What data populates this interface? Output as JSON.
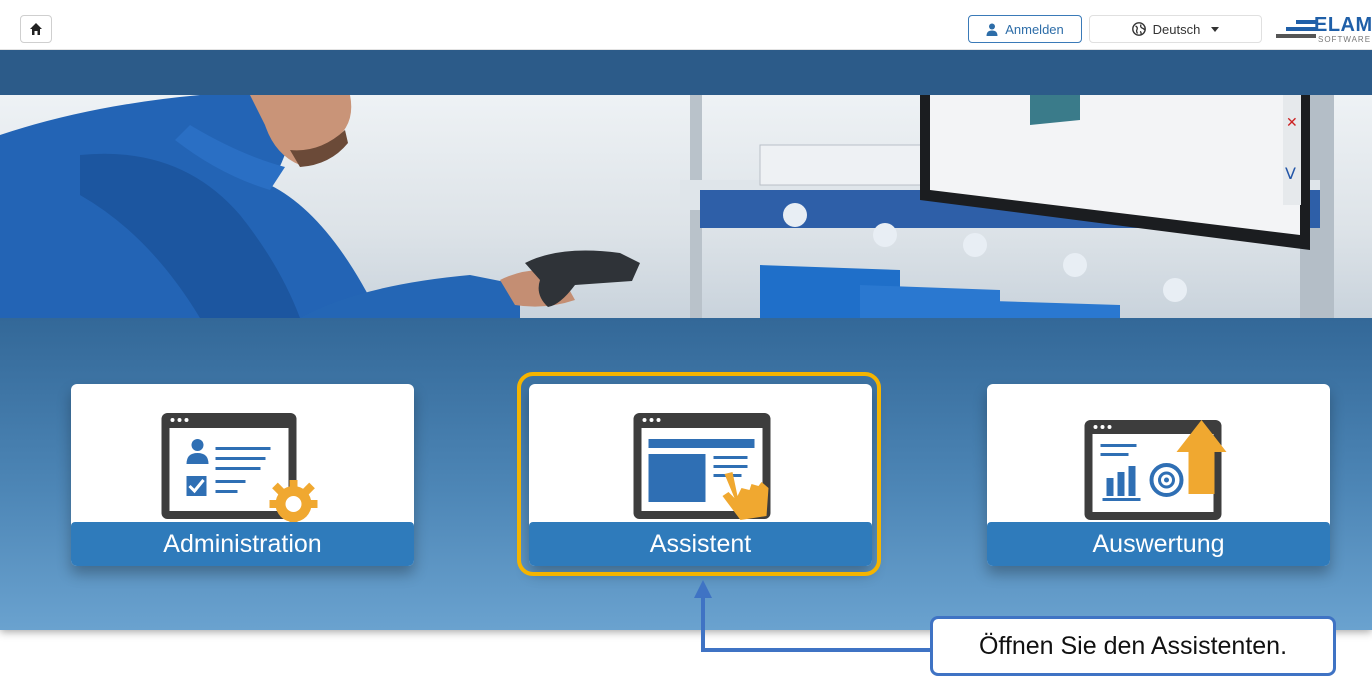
{
  "header": {
    "login_label": "Anmelden",
    "language_label": "Deutsch",
    "logo_text": "ELAM",
    "logo_sub": "SOFTWARE"
  },
  "tiles": [
    {
      "label": "Administration",
      "icon": "admin-settings-icon"
    },
    {
      "label": "Assistent",
      "icon": "assistant-pointer-icon"
    },
    {
      "label": "Auswertung",
      "icon": "evaluation-chart-icon"
    }
  ],
  "callout": {
    "text": "Öffnen Sie den Assistenten."
  },
  "colors": {
    "nav": "#2c5b89",
    "tile_label": "#2f7bbb",
    "highlight": "#f5b400",
    "callout_border": "#3f73c4",
    "accent_icon": "#f0a830"
  }
}
